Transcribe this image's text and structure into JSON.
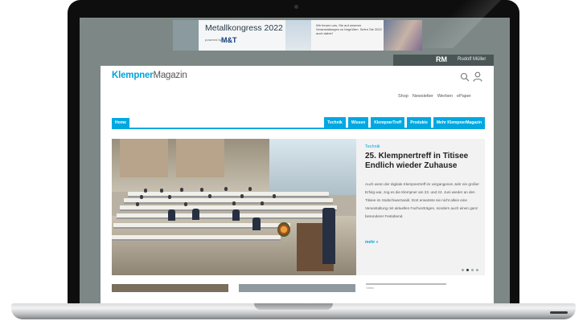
{
  "ad": {
    "title": "Metallkongress 2022",
    "brand": "M&T",
    "small": "powered by",
    "text": "Wir freuen uns, Sie auf unseren Veranstaltungen zu begrüßen. Seien Sie 2022 auch dabei!"
  },
  "user": {
    "initials": "RM",
    "name": "Rudolf Müller"
  },
  "site": {
    "logo_bold": "Klempner",
    "logo_regular": "Magazin",
    "top_links": [
      "Shop",
      "Newsletter",
      "Werben",
      "ePaper"
    ],
    "nav_home": "Home",
    "nav_items": [
      "Technik",
      "Wissen",
      "KlempnerTreff",
      "Produkte",
      "Mehr KlempnerMagazin"
    ]
  },
  "hero": {
    "category": "Technik",
    "title": "25. Klempnertreff in Titisee Endlich wieder Zuhause",
    "text": "Auch wenn der digitale Klempnertreff im vergangenen Jahr ein großer Erfolg war, zog es die Klempner am 23. und 24. Juni wieder an den Titisee im Südschwarzwald. Dort erwartete sie nicht allein eine Veranstaltung mit aktuellen Fachvorträgen, sondern auch einen ganz besonderer Festabend.",
    "more": "mehr »",
    "slides": 4,
    "active_slide": 2
  },
  "teasers": {
    "third_label": "Video"
  },
  "colors": {
    "accent": "#00a8e1",
    "bezel": "#0e0e0e",
    "page_bg": "#7d8886"
  },
  "icons": [
    "search-icon",
    "user-icon",
    "camera-icon"
  ]
}
